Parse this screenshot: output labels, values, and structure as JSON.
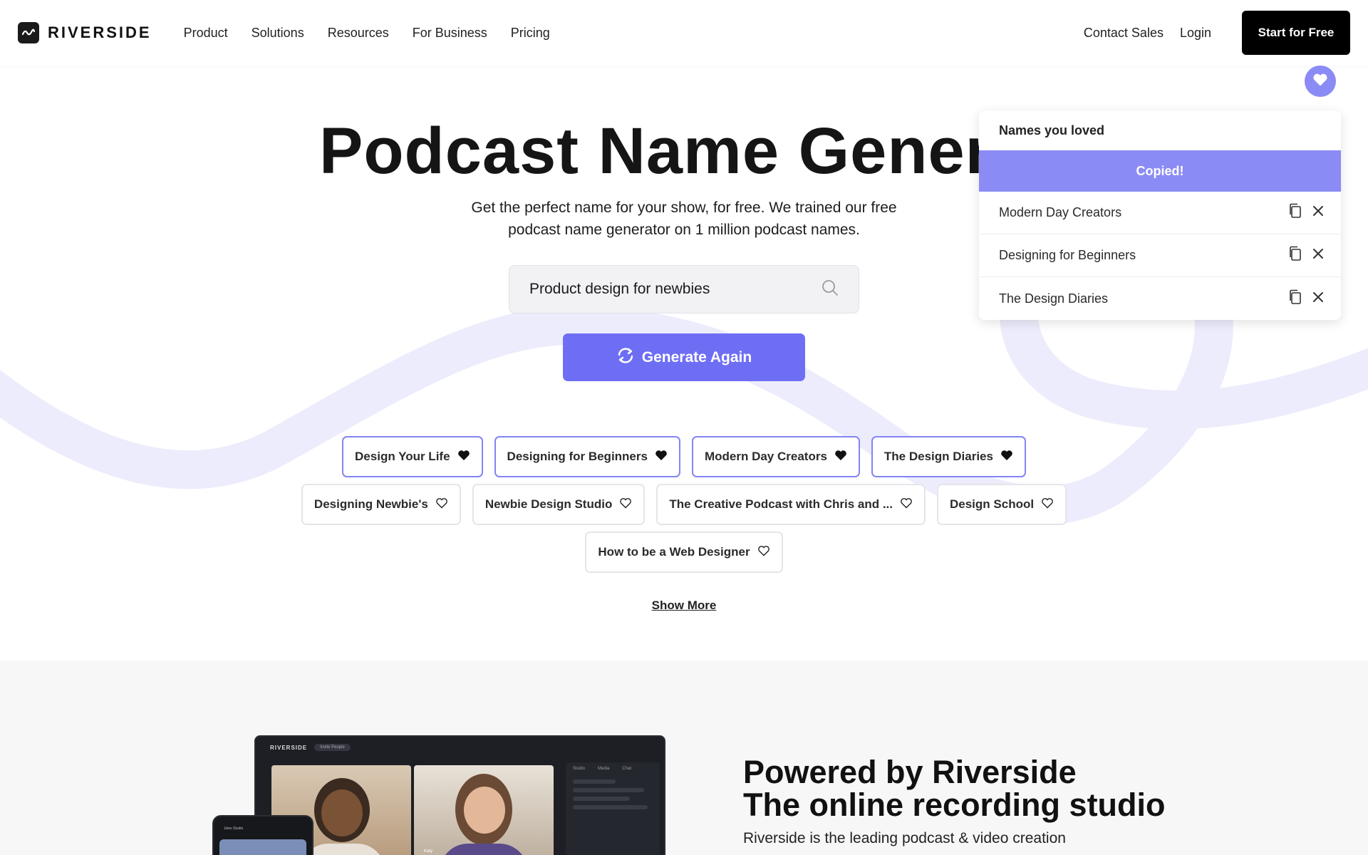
{
  "nav": {
    "brand": "RIVERSIDE",
    "links": [
      "Product",
      "Solutions",
      "Resources",
      "For Business",
      "Pricing"
    ],
    "contact_sales": "Contact Sales",
    "login": "Login",
    "start_free": "Start for Free"
  },
  "hero": {
    "title": "Podcast Name Generator",
    "subtitle": "Get the perfect name for your show, for free. We trained our free podcast name generator on 1 million podcast names.",
    "search_value": "Product design for newbies",
    "generate_label": "Generate Again",
    "show_more": "Show More"
  },
  "chips": {
    "row1": [
      {
        "label": "Design Your Life",
        "loved": true
      },
      {
        "label": "Designing for Beginners",
        "loved": true
      },
      {
        "label": "Modern Day Creators",
        "loved": true
      },
      {
        "label": "The Design Diaries",
        "loved": true
      }
    ],
    "row2": [
      {
        "label": "Designing Newbie's",
        "loved": false
      },
      {
        "label": "Newbie Design Studio",
        "loved": false
      },
      {
        "label": "The Creative Podcast with Chris and ...",
        "loved": false
      },
      {
        "label": "Design School",
        "loved": false
      }
    ],
    "row3": [
      {
        "label": "How to be a Web Designer",
        "loved": false
      }
    ]
  },
  "loved_panel": {
    "title": "Names you loved",
    "copied": "Copied!",
    "items": [
      "Modern Day Creators",
      "Designing for Beginners",
      "The Design Diaries"
    ]
  },
  "lower": {
    "title_line1": "Powered by Riverside",
    "title_line2": "The online recording studio",
    "description": "Riverside is the leading podcast & video creation",
    "device_logo": "RIVERSIDE",
    "device_pill": "Invite People",
    "device_tabs": [
      "Studio",
      "Media",
      "Chat"
    ],
    "tile_name": "Katy",
    "phone_label": "Jules Studio"
  },
  "colors": {
    "accent": "#6e6ef5",
    "accent_light": "#8b8bf5",
    "wave": "#e9e9fc"
  }
}
